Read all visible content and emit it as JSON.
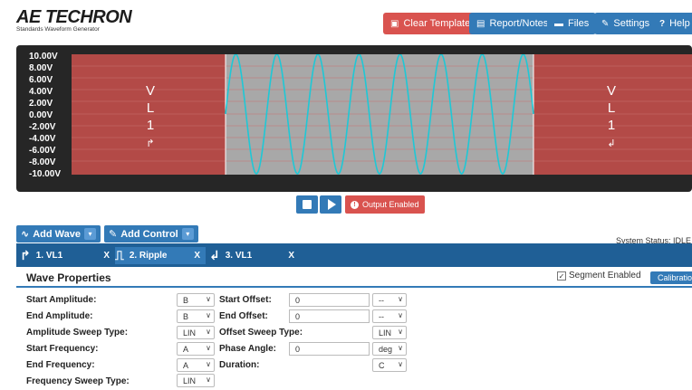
{
  "header": {
    "logo_text": "AE TECHRON",
    "logo_sub": "Standards Waveform Generator",
    "buttons": [
      {
        "label": "Clear Template",
        "icon": "clear-icon"
      },
      {
        "label": "Report/Notes",
        "icon": "document-icon"
      },
      {
        "label": "Files",
        "icon": "folder-icon"
      },
      {
        "label": "Settings",
        "icon": "wrench-icon"
      },
      {
        "label": "Help",
        "icon": "help-icon"
      }
    ]
  },
  "scope": {
    "y_ticks": [
      "10.00V",
      "8.00V",
      "6.00V",
      "4.00V",
      "2.00V",
      "0.00V",
      "-2.00V",
      "-4.00V",
      "-6.00V",
      "-8.00V",
      "-10.00V"
    ],
    "segments": [
      {
        "label_letters": [
          "V",
          "L",
          "1"
        ],
        "arrow": "↱"
      },
      {
        "label_letters": [],
        "arrow": ""
      },
      {
        "label_letters": [
          "V",
          "L",
          "1"
        ],
        "arrow": "↲"
      }
    ],
    "colors": {
      "background": "#262626",
      "segment_red": "#b34a47",
      "segment_gray": "#a8a8a8",
      "wave": "#1ec8d6"
    }
  },
  "transport": {
    "output_label": "Output Enabled"
  },
  "controls": {
    "add_wave": "Add Wave",
    "add_control": "Add Control",
    "system_status": "System Status: IDLE"
  },
  "segments_tabs": [
    {
      "label": "1. VL1",
      "close": "X"
    },
    {
      "label": "2. Ripple",
      "close": "X"
    },
    {
      "label": "3. VL1",
      "close": "X"
    }
  ],
  "properties": {
    "title": "Wave Properties",
    "segment_enabled": "Segment Enabled",
    "calibration": "Calibration",
    "left_rows": [
      {
        "label": "Start Amplitude:",
        "select": "B"
      },
      {
        "label": "End Amplitude:",
        "select": "B"
      },
      {
        "label": "Amplitude Sweep Type:",
        "select": "LIN"
      },
      {
        "label": "Start Frequency:",
        "select": "A"
      },
      {
        "label": "End Frequency:",
        "select": "A"
      },
      {
        "label": "Frequency Sweep Type:",
        "select": "LIN"
      }
    ],
    "right_rows": [
      {
        "label": "Start Offset:",
        "input": "0",
        "select": "--"
      },
      {
        "label": "End Offset:",
        "input": "0",
        "select": "--"
      },
      {
        "label": "Offset Sweep Type:",
        "input": "",
        "select": "LIN"
      },
      {
        "label": "Phase Angle:",
        "input": "0",
        "select": "deg"
      },
      {
        "label": "Duration:",
        "input": "",
        "select": "C"
      }
    ]
  }
}
